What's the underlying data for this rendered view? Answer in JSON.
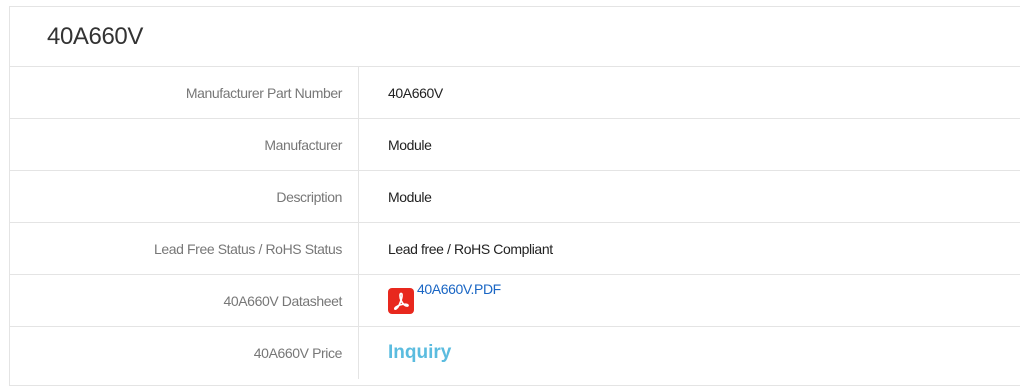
{
  "title": "40A660V",
  "rows": [
    {
      "label": "Manufacturer Part Number",
      "value": "40A660V"
    },
    {
      "label": "Manufacturer",
      "value": "Module"
    },
    {
      "label": "Description",
      "value": "Module"
    },
    {
      "label": "Lead Free Status / RoHS Status",
      "value": "Lead free / RoHS Compliant"
    },
    {
      "label": "40A660V Datasheet",
      "value": "40A660V.PDF",
      "icon": "pdf-icon"
    },
    {
      "label": "40A660V Price",
      "value": "Inquiry"
    }
  ],
  "colors": {
    "border": "#e4e4e4",
    "label_text": "#777777",
    "value_text": "#222222",
    "link": "#1a66c4",
    "inquiry": "#5bbcdf",
    "pdf_icon": "#e8281e"
  }
}
